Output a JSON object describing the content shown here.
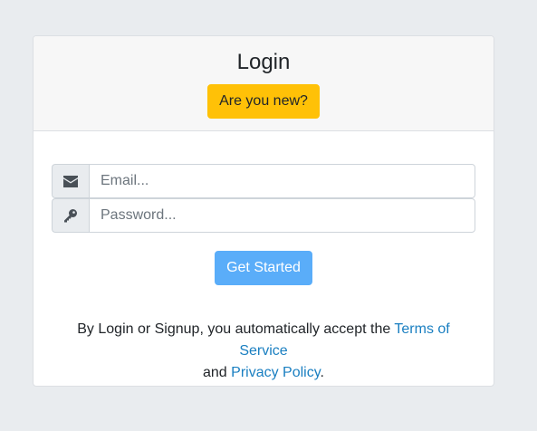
{
  "header": {
    "title": "Login",
    "new_button_label": "Are you new?"
  },
  "form": {
    "email": {
      "placeholder": "Email...",
      "value": "",
      "icon": "envelope-icon"
    },
    "password": {
      "placeholder": "Password...",
      "value": "",
      "icon": "key-icon"
    },
    "submit_label": "Get Started"
  },
  "terms": {
    "prefix": "By Login or Signup, you automatically accept the ",
    "terms_link": "Terms of Service",
    "middle": "and ",
    "privacy_link": "Privacy Policy",
    "suffix": "."
  },
  "colors": {
    "page_background": "#e9ecef",
    "warning_button": "#ffc107",
    "primary_button": "#5aadf9",
    "link": "#1a7fc1"
  }
}
